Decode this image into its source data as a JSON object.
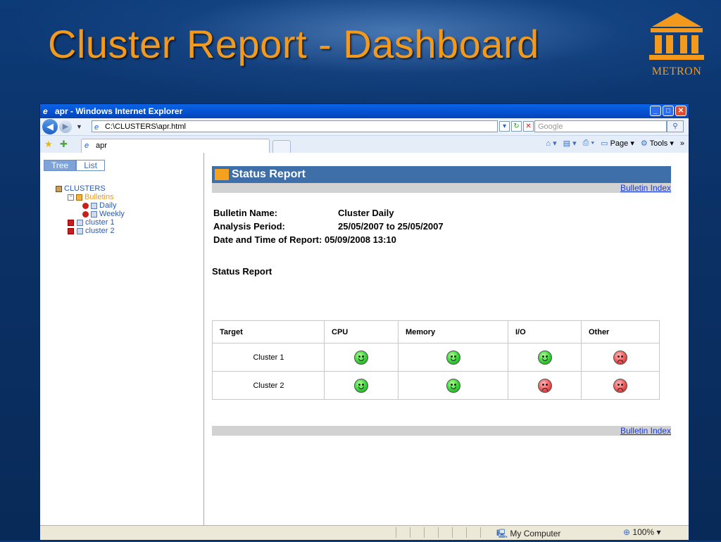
{
  "slide": {
    "title": "Cluster Report - Dashboard",
    "logo_text": "METRON"
  },
  "window": {
    "title": "apr - Windows Internet Explorer",
    "address": "C:\\CLUSTERS\\apr.html",
    "search_placeholder": "Google",
    "tab_title": "apr",
    "cmd_page": "Page",
    "cmd_tools": "Tools",
    "more": "»"
  },
  "left_pane": {
    "tabs": [
      {
        "label": "Tree",
        "active": true
      },
      {
        "label": "List",
        "active": false
      }
    ],
    "tree": {
      "root": "CLUSTERS",
      "bulletins": "Bulletins",
      "daily": "Daily",
      "weekly": "Weekly",
      "cluster1": "cluster 1",
      "cluster2": "cluster 2"
    }
  },
  "report": {
    "header": "Status Report",
    "bulletin_index_top": "Bulletin Index",
    "bulletin_index_bottom": "Bulletin Index",
    "meta": {
      "bulletin_name_label": "Bulletin Name:",
      "bulletin_name_value": "Cluster Daily",
      "analysis_period_label": "Analysis Period:",
      "analysis_period_value": "25/05/2007 to 25/05/2007",
      "date_time_label": "Date and Time of Report:",
      "date_time_value": "05/09/2008 13:10"
    },
    "subtitle": "Status Report",
    "table": {
      "headers": [
        "Target",
        "CPU",
        "Memory",
        "I/O",
        "Other"
      ],
      "rows": [
        {
          "target": "Cluster 1",
          "statuses": [
            "good",
            "good",
            "good",
            "bad"
          ]
        },
        {
          "target": "Cluster 2",
          "statuses": [
            "good",
            "good",
            "bad",
            "bad"
          ]
        }
      ]
    }
  },
  "statusbar": {
    "zone": "My Computer",
    "zoom": "100%"
  },
  "colors": {
    "slide_title": "#f39a1c",
    "report_header_bg": "#3f6fa8",
    "good": "#33d233",
    "bad": "#f05252",
    "link": "#1b3ad6"
  }
}
